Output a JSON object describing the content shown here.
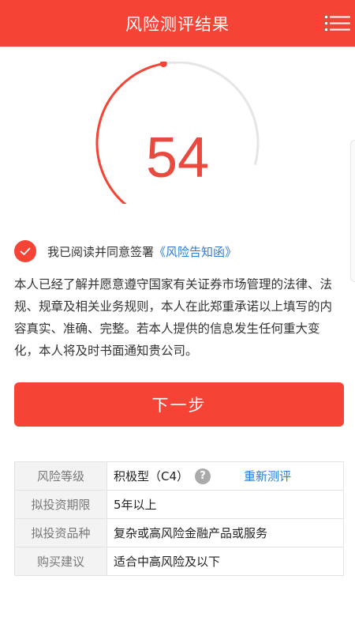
{
  "header": {
    "title": "风险测评结果",
    "background_color": "#f54335",
    "menu_icon": "list-menu-icon"
  },
  "score": {
    "value": "54",
    "gauge_fraction": 0.54,
    "color": "#e84a3f"
  },
  "agreement": {
    "checked": true,
    "text": "我已阅读并同意签署",
    "link_text": "《风险告知函》"
  },
  "disclaimer": "本人已经了解并愿意遵守国家有关证券市场管理的法律、法规、规章及相关业务规则，本人在此郑重承诺以上填写的内容真实、准确、完整。若本人提供的信息发生任何重大变化，本人将及时书面通知贵公司。",
  "next_button": {
    "label": "下一步"
  },
  "result_table": {
    "rows": [
      {
        "label": "风险等级",
        "value": "积极型（C4）",
        "help": "?",
        "action": "重新测评"
      },
      {
        "label": "拟投资期限",
        "value": "5年以上"
      },
      {
        "label": "拟投资品种",
        "value": "复杂或高风险金融产品或服务"
      },
      {
        "label": "购买建议",
        "value": "适合中高风险及以下"
      }
    ]
  },
  "colors": {
    "accent": "#f54335",
    "link": "#2f7ad3",
    "gauge_track": "#e5e5e5"
  }
}
